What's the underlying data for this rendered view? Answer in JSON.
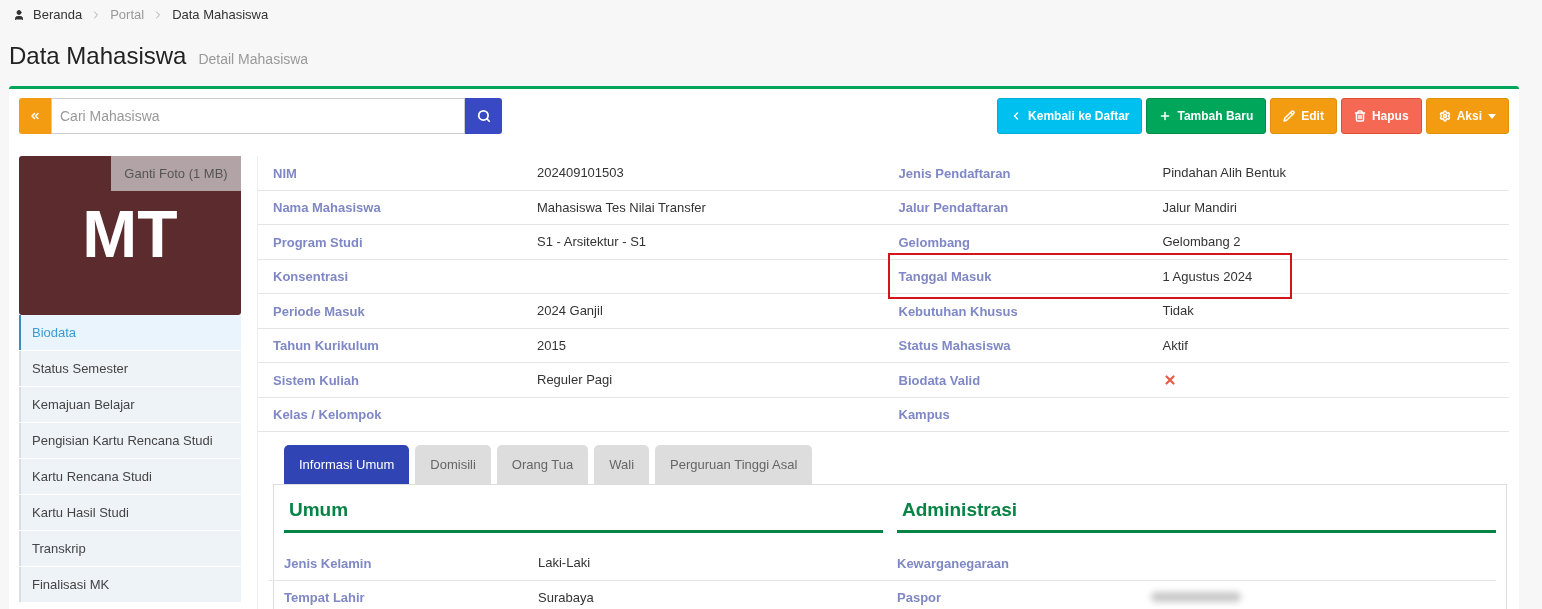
{
  "breadcrumb": [
    {
      "label": "Beranda"
    },
    {
      "label": "Portal"
    },
    {
      "label": "Data Mahasiswa"
    }
  ],
  "page_title": "Data Mahasiswa",
  "page_subtitle": "Detail Mahasiswa",
  "search": {
    "placeholder": "Cari Mahasiswa"
  },
  "actions": [
    {
      "label": "Kembali ke Daftar",
      "kind": "back"
    },
    {
      "label": "Tambah Baru",
      "kind": "add"
    },
    {
      "label": "Edit",
      "kind": "edit"
    },
    {
      "label": "Hapus",
      "kind": "delete"
    },
    {
      "label": "Aksi",
      "kind": "menu"
    }
  ],
  "profile": {
    "initials": "MT",
    "change_photo": "Ganti Foto (1 MB)"
  },
  "sidebar": {
    "items": [
      {
        "label": "Biodata",
        "selected": true
      },
      {
        "label": "Status Semester",
        "selected": false
      },
      {
        "label": "Kemajuan Belajar",
        "selected": false
      },
      {
        "label": "Pengisian Kartu Rencana Studi",
        "selected": false
      },
      {
        "label": "Kartu Rencana Studi",
        "selected": false
      },
      {
        "label": "Kartu Hasil Studi",
        "selected": false
      },
      {
        "label": "Transkrip",
        "selected": false
      },
      {
        "label": "Finalisasi MK",
        "selected": false
      }
    ]
  },
  "details_left": [
    {
      "label": "NIM",
      "kind": "text",
      "value": "202409101503",
      "highlighted": false
    },
    {
      "label": "Nama Mahasiswa",
      "kind": "text",
      "value": "Mahasiswa Tes Nilai Transfer",
      "highlighted": false
    },
    {
      "label": "Program Studi",
      "kind": "text",
      "value": "S1 - Arsitektur - S1",
      "highlighted": false
    },
    {
      "label": "Konsentrasi",
      "kind": "text",
      "highlighted": false
    },
    {
      "label": "Periode Masuk",
      "kind": "text",
      "value": "2024 Ganjil",
      "highlighted": false
    },
    {
      "label": "Tahun Kurikulum",
      "kind": "text",
      "value": "2015",
      "highlighted": false
    },
    {
      "label": "Sistem Kuliah",
      "kind": "text",
      "value": "Reguler Pagi",
      "highlighted": false
    },
    {
      "label": "Kelas / Kelompok",
      "kind": "text",
      "highlighted": false
    }
  ],
  "details_right": [
    {
      "label": "Jenis Pendaftaran",
      "kind": "text",
      "value": "Pindahan Alih Bentuk",
      "highlighted": false
    },
    {
      "label": "Jalur Pendaftaran",
      "kind": "text",
      "value": "Jalur Mandiri",
      "highlighted": false
    },
    {
      "label": "Gelombang",
      "kind": "text",
      "value": "Gelombang 2",
      "highlighted": false
    },
    {
      "label": "Tanggal Masuk",
      "kind": "text",
      "value": "1 Agustus 2024",
      "highlighted": true
    },
    {
      "label": "Kebutuhan Khusus",
      "kind": "text",
      "value": "Tidak",
      "highlighted": false
    },
    {
      "label": "Status Mahasiswa",
      "kind": "text",
      "value": "Aktif",
      "highlighted": false
    },
    {
      "label": "Biodata Valid",
      "kind": "flag",
      "checked": false,
      "highlighted": false
    },
    {
      "label": "Kampus",
      "kind": "text",
      "highlighted": false
    }
  ],
  "tabs": [
    {
      "label": "Informasi Umum",
      "selected": true
    },
    {
      "label": "Domisili",
      "selected": false
    },
    {
      "label": "Orang Tua",
      "selected": false
    },
    {
      "label": "Wali",
      "selected": false
    },
    {
      "label": "Perguruan Tinggi Asal",
      "selected": false
    }
  ],
  "sections": [
    {
      "title": "Umum",
      "rows": [
        {
          "label": "Jenis Kelamin",
          "kind": "text",
          "value": "Laki-Laki"
        },
        {
          "label": "Tempat Lahir",
          "kind": "text",
          "value": "Surabaya"
        }
      ]
    },
    {
      "title": "Administrasi",
      "rows": [
        {
          "label": "Kewarganegaraan",
          "kind": "text"
        },
        {
          "label": "Paspor",
          "kind": "redacted"
        }
      ]
    }
  ]
}
